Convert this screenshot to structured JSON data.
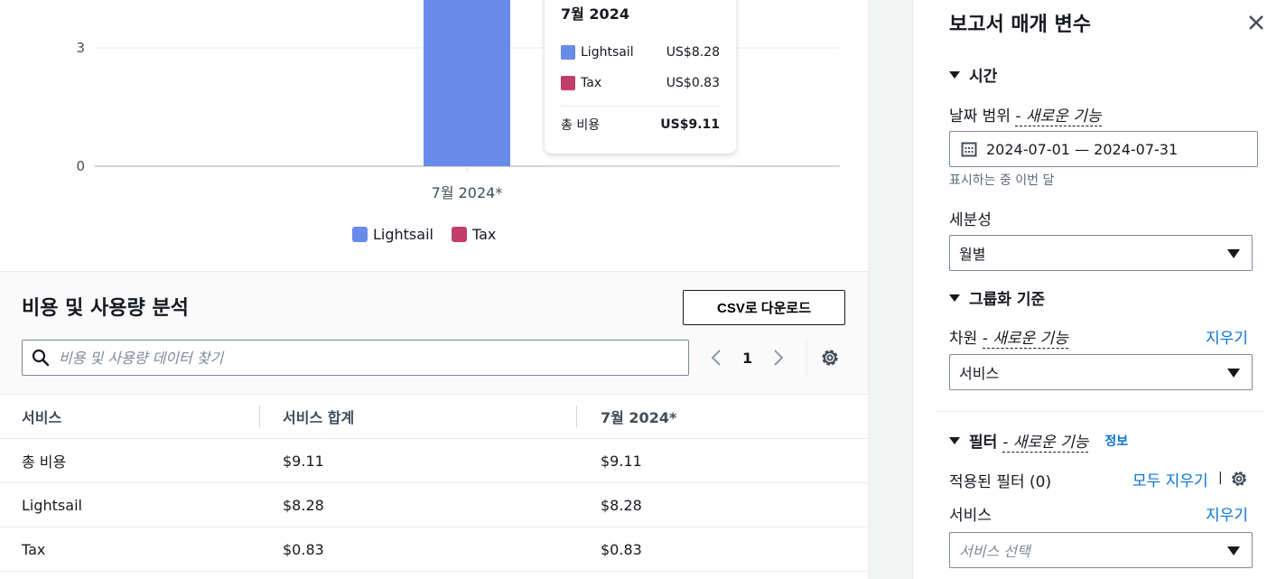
{
  "chart_data": {
    "type": "bar",
    "stacked": true,
    "categories": [
      "7월 2024*"
    ],
    "series": [
      {
        "name": "Lightsail",
        "values": [
          8.28
        ],
        "color": "#688ae8"
      },
      {
        "name": "Tax",
        "values": [
          0.83
        ],
        "color": "#c33d69"
      }
    ],
    "y_ticks_visible": [
      "0",
      "3"
    ],
    "ylim": [
      0,
      10
    ],
    "grid": true,
    "legend_position": "bottom",
    "tooltip": {
      "title": "7월 2024",
      "rows": [
        {
          "label": "Lightsail",
          "value": "US$8.28",
          "color": "#688ae8"
        },
        {
          "label": "Tax",
          "value": "US$0.83",
          "color": "#c33d69"
        }
      ],
      "total_label": "총 비용",
      "total_value": "US$9.11"
    }
  },
  "analysis": {
    "title": "비용 및 사용량 분석",
    "csv_button": "CSV로 다운로드",
    "search_placeholder": "비용 및 사용량 데이터 찾기",
    "page": "1",
    "columns": [
      "서비스",
      "서비스 합계",
      "7월 2024*"
    ],
    "rows": [
      [
        "총 비용",
        "$9.11",
        "$9.11"
      ],
      [
        "Lightsail",
        "$8.28",
        "$8.28"
      ],
      [
        "Tax",
        "$0.83",
        "$0.83"
      ]
    ]
  },
  "panel": {
    "title": "보고서 매개 변수",
    "time_section": "시간",
    "date_range_label": "날짜 범위",
    "new_feature": "- 새로운 기능",
    "date_range_value": "2024-07-01 — 2024-07-31",
    "date_hint": "표시하는 중 이번 달",
    "granularity_label": "세분성",
    "granularity_value": "월별",
    "group_section": "그룹화 기준",
    "dimension_label": "차원",
    "clear_link": "지우기",
    "dimension_value": "서비스",
    "filter_section": "필터",
    "info_link": "정보",
    "applied_filters": "적용된 필터 (0)",
    "clear_all_link": "모두 지우기",
    "service_label": "서비스",
    "service_placeholder": "서비스 선택"
  }
}
